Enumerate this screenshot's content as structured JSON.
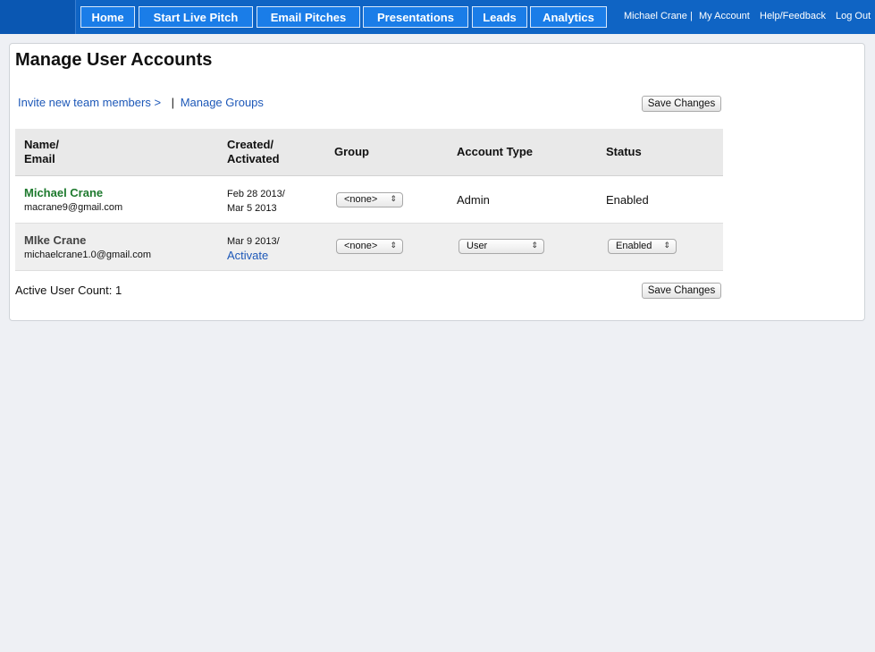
{
  "nav": {
    "items": [
      "Home",
      "Start Live Pitch",
      "Email Pitches",
      "Presentations",
      "Leads",
      "Analytics"
    ],
    "user_name": "Michael Crane",
    "separator": "|",
    "my_account": "My Account",
    "help": "Help/Feedback",
    "logout": "Log Out"
  },
  "page": {
    "title": "Manage User Accounts",
    "invite_link": "Invite new team members >",
    "links_separator": "|",
    "groups_link": "Manage Groups",
    "save_label": "Save Changes",
    "active_count": "Active User Count: 1"
  },
  "table": {
    "headers": {
      "name_line1": "Name/",
      "name_line2": "Email",
      "created_line1": "Created/",
      "created_line2": "Activated",
      "group": "Group",
      "account_type": "Account Type",
      "status": "Status"
    },
    "rows": [
      {
        "name": "Michael Crane",
        "email": "macrane9@gmail.com",
        "created": "Feb 28 2013/",
        "activated": "Mar 5 2013",
        "group": "<none>",
        "account_type": "Admin",
        "status": "Enabled"
      },
      {
        "name": "MIke Crane",
        "email": "michaelcrane1.0@gmail.com",
        "created": "Mar 9 2013/",
        "activated": "Activate",
        "group": "<none>",
        "account_type": "User",
        "status": "Enabled"
      }
    ]
  },
  "colors": {
    "nav_bg": "#0f64c4",
    "nav_button": "#1a7de8",
    "active_name": "#1e7a2e",
    "inactive_name": "#444444",
    "link": "#1d58b8"
  },
  "icons": {
    "select_arrow": "updown-arrows-icon"
  }
}
